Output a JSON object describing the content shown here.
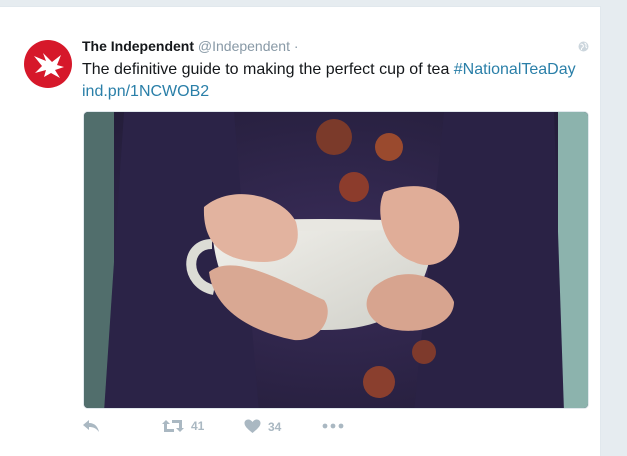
{
  "tweet": {
    "author_name": "The Independent",
    "author_handle": "@Independent",
    "separator": "·",
    "text": "The definitive guide to making the perfect cup of tea ",
    "hashtag": "#NationalTeaDay",
    "link": "ind.pn/1NCWOB2",
    "retweets": "41",
    "likes": "34"
  },
  "icons": {
    "avatar": "independent-eagle-logo",
    "globe": "globe-icon",
    "reply": "reply-icon",
    "retweet": "retweet-icon",
    "like": "heart-icon",
    "more": "more-icon"
  },
  "colors": {
    "brand_red": "#d6182a",
    "link": "#2a7fa8",
    "muted": "#aab8c2"
  }
}
